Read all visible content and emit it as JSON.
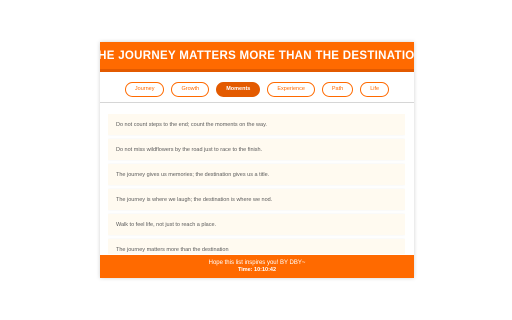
{
  "header": {
    "title": "THE JOURNEY MATTERS MORE THAN THE DESTINATION"
  },
  "tabs": [
    {
      "label": "Journey",
      "active": false
    },
    {
      "label": "Growth",
      "active": false
    },
    {
      "label": "Moments",
      "active": true
    },
    {
      "label": "Experience",
      "active": false
    },
    {
      "label": "Path",
      "active": false
    },
    {
      "label": "Life",
      "active": false
    }
  ],
  "quotes": [
    "Do not count steps to the end; count the moments on the way.",
    "Do not miss wildflowers by the road just to race to the finish.",
    "The journey gives us memories; the destination gives us a title.",
    "The journey is where we laugh; the destination is where we nod.",
    "Walk to feel life, not just to reach a place.",
    "The journey matters more than the destination"
  ],
  "footer": {
    "message": "Hope this list inspires you! BY DBY~",
    "time": "Time: 10:10:42"
  },
  "colors": {
    "accent": "#ff6a00",
    "accent_dark": "#e35a00",
    "card_bg": "#fffaf0"
  }
}
